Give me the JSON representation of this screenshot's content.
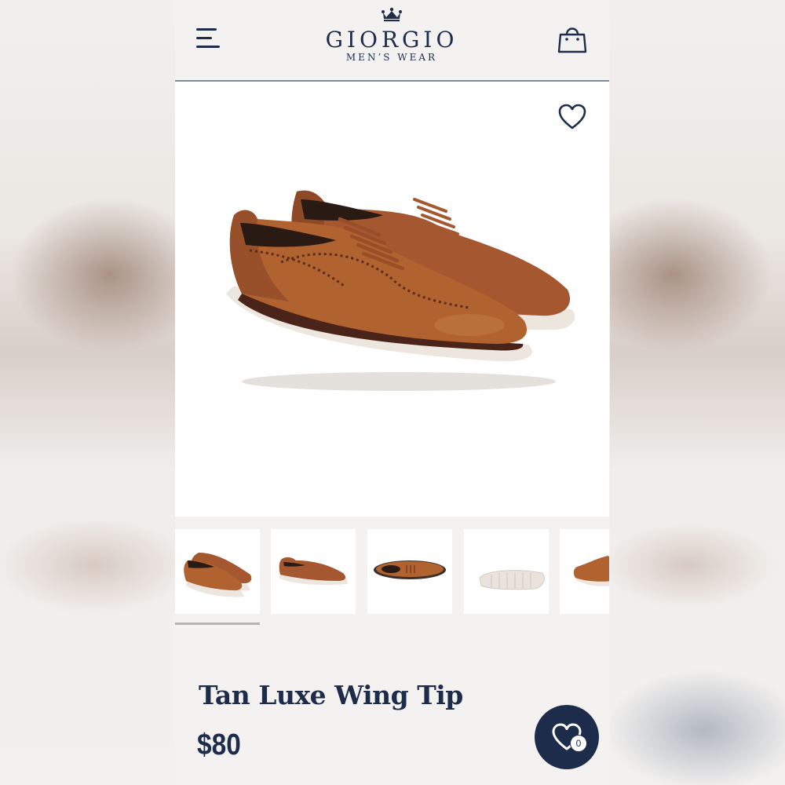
{
  "header": {
    "brand": "GIORGIO",
    "tagline": "MEN’S WEAR",
    "icons": {
      "menu": "hamburger-menu-icon",
      "crown": "crown-icon",
      "cart": "shopping-bag-icon"
    }
  },
  "product": {
    "title": "Tan Luxe Wing Tip",
    "price": "$80",
    "favorite_icon": "heart-outline-icon"
  },
  "gallery": {
    "active_index": 0,
    "thumbnail_count": 5
  },
  "wishlist": {
    "count": "0",
    "icon": "heart-icon"
  },
  "colors": {
    "navy": "#1d2c4a",
    "leather": "#a5582f",
    "sole": "#ece6de"
  }
}
